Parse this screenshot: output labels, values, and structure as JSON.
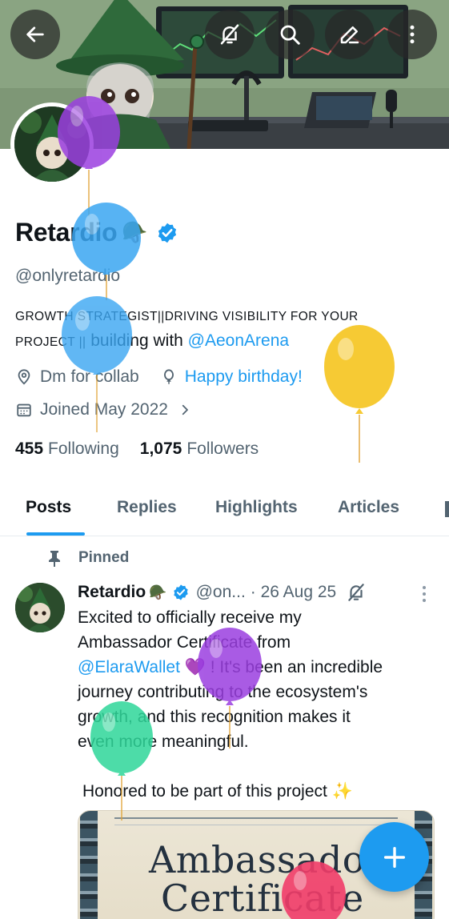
{
  "header": {
    "back_icon": "arrow-left-icon",
    "actions": [
      "bell-off-icon",
      "search-icon",
      "edit-icon",
      "more-vertical-icon"
    ]
  },
  "profile": {
    "display_name": "Retardio",
    "name_emoji": "🪖",
    "handle": "@onlyretardio",
    "bio_caps": "GROWTH STRATEGIST||DRIVING VISIBILITY FOR YOUR PROJECT ||",
    "bio_line1": "GROWTH STRATEGIST||DRIVING VISIBILITY FOR YOUR",
    "bio_line2_caps": "PROJECT ||",
    "bio_line2_text": " building with ",
    "bio_mention": "@AeonArena",
    "location": "Dm for collab",
    "birthday": "Happy birthday!",
    "joined": "Joined May 2022",
    "following_count": "455",
    "following_label": "Following",
    "followers_count": "1,075",
    "followers_label": "Followers"
  },
  "tabs": [
    {
      "label": "Posts",
      "active": true
    },
    {
      "label": "Replies",
      "active": false
    },
    {
      "label": "Highlights",
      "active": false
    },
    {
      "label": "Articles",
      "active": false
    }
  ],
  "pinned_post": {
    "pinned_label": "Pinned",
    "author_name": "Retardio",
    "author_emoji": "🪖",
    "handle_short": "@on...",
    "date": "· 26 Aug 25",
    "text_line1": "Excited to officially receive my",
    "text_line2": "Ambassador Certificate from",
    "mention": "@ElaraWallet",
    "text_line3_rest": " 💜 ! It's been an incredible",
    "text_line4": "journey contributing to the ecosystem's",
    "text_line5": "growth, and this recognition makes it",
    "text_line6": "even more meaningful.",
    "text_line7": "Honored to be part of this project ✨",
    "image_title1": "Ambassador",
    "image_title2": "Certificate"
  },
  "fab": {
    "icon": "plus-icon"
  },
  "colors": {
    "accent": "#1d9bf0",
    "text": "#0f1419",
    "secondary": "#536471",
    "balloon_purple": "#9b3fe0",
    "balloon_blue": "#3aa6f2",
    "balloon_yellow": "#f6c51f",
    "balloon_green": "#2fd79a",
    "balloon_pink": "#f13d6a"
  }
}
